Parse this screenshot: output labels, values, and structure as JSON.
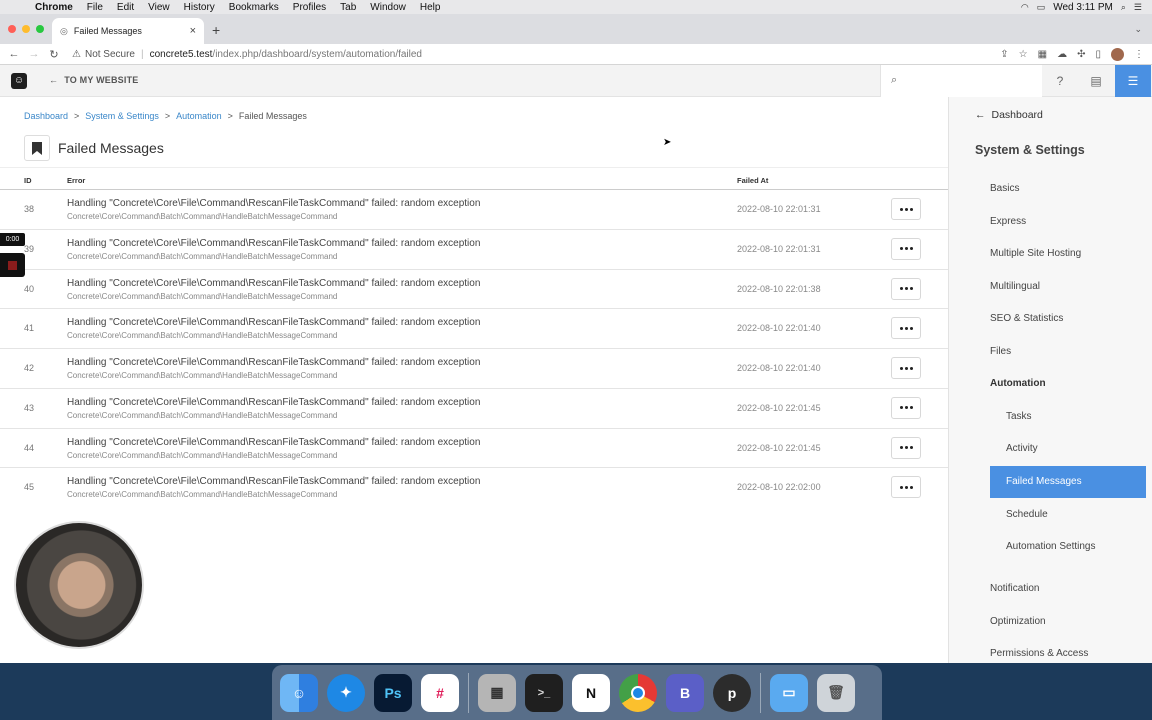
{
  "menubar": {
    "items": [
      "Chrome",
      "File",
      "Edit",
      "View",
      "History",
      "Bookmarks",
      "Profiles",
      "Tab",
      "Window",
      "Help"
    ],
    "clock": "Wed 3:11 PM"
  },
  "browser": {
    "tab_title": "Failed Messages",
    "not_secure": "Not Secure",
    "url_host": "concrete5.test",
    "url_path": "/index.php/dashboard/system/automation/failed"
  },
  "toolbar": {
    "back_to_site": "TO MY WEBSITE"
  },
  "breadcrumb": [
    {
      "label": "Dashboard",
      "link": true
    },
    {
      "label": "System & Settings",
      "link": true
    },
    {
      "label": "Automation",
      "link": true
    },
    {
      "label": "Failed Messages",
      "link": false
    }
  ],
  "page": {
    "title": "Failed Messages",
    "columns": {
      "id": "ID",
      "error": "Error",
      "failed_at": "Failed At"
    }
  },
  "rows": [
    {
      "id": "38",
      "error": "Handling \"Concrete\\Core\\File\\Command\\RescanFileTaskCommand\" failed: random exception",
      "command": "Concrete\\Core\\Command\\Batch\\Command\\HandleBatchMessageCommand",
      "failed_at": "2022-08-10 22:01:31"
    },
    {
      "id": "39",
      "error": "Handling \"Concrete\\Core\\File\\Command\\RescanFileTaskCommand\" failed: random exception",
      "command": "Concrete\\Core\\Command\\Batch\\Command\\HandleBatchMessageCommand",
      "failed_at": "2022-08-10 22:01:31"
    },
    {
      "id": "40",
      "error": "Handling \"Concrete\\Core\\File\\Command\\RescanFileTaskCommand\" failed: random exception",
      "command": "Concrete\\Core\\Command\\Batch\\Command\\HandleBatchMessageCommand",
      "failed_at": "2022-08-10 22:01:38"
    },
    {
      "id": "41",
      "error": "Handling \"Concrete\\Core\\File\\Command\\RescanFileTaskCommand\" failed: random exception",
      "command": "Concrete\\Core\\Command\\Batch\\Command\\HandleBatchMessageCommand",
      "failed_at": "2022-08-10 22:01:40"
    },
    {
      "id": "42",
      "error": "Handling \"Concrete\\Core\\File\\Command\\RescanFileTaskCommand\" failed: random exception",
      "command": "Concrete\\Core\\Command\\Batch\\Command\\HandleBatchMessageCommand",
      "failed_at": "2022-08-10 22:01:40"
    },
    {
      "id": "43",
      "error": "Handling \"Concrete\\Core\\File\\Command\\RescanFileTaskCommand\" failed: random exception",
      "command": "Concrete\\Core\\Command\\Batch\\Command\\HandleBatchMessageCommand",
      "failed_at": "2022-08-10 22:01:45"
    },
    {
      "id": "44",
      "error": "Handling \"Concrete\\Core\\File\\Command\\RescanFileTaskCommand\" failed: random exception",
      "command": "Concrete\\Core\\Command\\Batch\\Command\\HandleBatchMessageCommand",
      "failed_at": "2022-08-10 22:01:45"
    },
    {
      "id": "45",
      "error": "Handling \"Concrete\\Core\\File\\Command\\RescanFileTaskCommand\" failed: random exception",
      "command": "Concrete\\Core\\Command\\Batch\\Command\\HandleBatchMessageCommand",
      "failed_at": "2022-08-10 22:02:00"
    }
  ],
  "sidebar": {
    "back_label": "Dashboard",
    "section_title": "System & Settings",
    "items": [
      {
        "label": "Basics",
        "level": 1
      },
      {
        "label": "Express",
        "level": 1
      },
      {
        "label": "Multiple Site Hosting",
        "level": 1
      },
      {
        "label": "Multilingual",
        "level": 1
      },
      {
        "label": "SEO & Statistics",
        "level": 1
      },
      {
        "label": "Files",
        "level": 1
      },
      {
        "label": "Automation",
        "level": 1,
        "bold": true
      },
      {
        "label": "Tasks",
        "level": 2
      },
      {
        "label": "Activity",
        "level": 2
      },
      {
        "label": "Failed Messages",
        "level": 2,
        "active": true
      },
      {
        "label": "Schedule",
        "level": 2
      },
      {
        "label": "Automation Settings",
        "level": 2
      },
      {
        "label": "Notification",
        "level": 1
      },
      {
        "label": "Optimization",
        "level": 1
      },
      {
        "label": "Permissions & Access",
        "level": 1
      }
    ]
  },
  "recording": {
    "timer": "0:00"
  },
  "colors": {
    "accent": "#4a90e2",
    "link": "#3a87c9"
  },
  "dock": {
    "apps": [
      "finder",
      "safari",
      "photoshop",
      "slack",
      "calculator",
      "terminal",
      "notion",
      "chrome",
      "bbedit",
      "p-app",
      "folder",
      "trash"
    ]
  }
}
